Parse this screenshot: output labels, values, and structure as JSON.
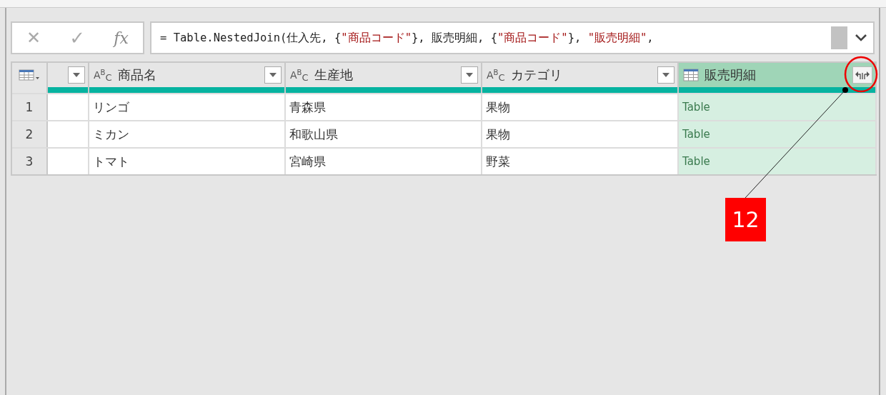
{
  "formula_bar": {
    "cancel": "✕",
    "confirm": "✓",
    "fx": "fx",
    "formula": [
      {
        "kind": "code",
        "text": "= Table.NestedJoin(仕入先, {"
      },
      {
        "kind": "string",
        "text": "\"商品コード\""
      },
      {
        "kind": "code",
        "text": "}, 販売明細, {"
      },
      {
        "kind": "string",
        "text": "\"商品コード\""
      },
      {
        "kind": "code",
        "text": "}, "
      },
      {
        "kind": "string",
        "text": "\"販売明細\""
      },
      {
        "kind": "code",
        "text": ","
      }
    ]
  },
  "table": {
    "columns": [
      {
        "kind": "blank",
        "selected": false
      },
      {
        "kind": "text",
        "type_icon": "A$^{B}$$_{C}$",
        "label": "商品名",
        "selected": false
      },
      {
        "kind": "text",
        "type_icon": "A$^{B}$$_{C}$",
        "label": "生産地",
        "selected": false
      },
      {
        "kind": "text",
        "type_icon": "A$^{B}$$_{C}$",
        "label": "カテゴリ",
        "selected": false
      },
      {
        "kind": "table",
        "label": "販売明細",
        "selected": true
      }
    ],
    "rows": [
      {
        "number": "1",
        "cells": [
          "",
          "リンゴ",
          "青森県",
          "果物",
          "Table"
        ]
      },
      {
        "number": "2",
        "cells": [
          "",
          "ミカン",
          "和歌山県",
          "果物",
          "Table"
        ]
      },
      {
        "number": "3",
        "cells": [
          "",
          "トマト",
          "宮崎県",
          "野菜",
          "Table"
        ]
      }
    ]
  },
  "callout": {
    "number": "12"
  }
}
